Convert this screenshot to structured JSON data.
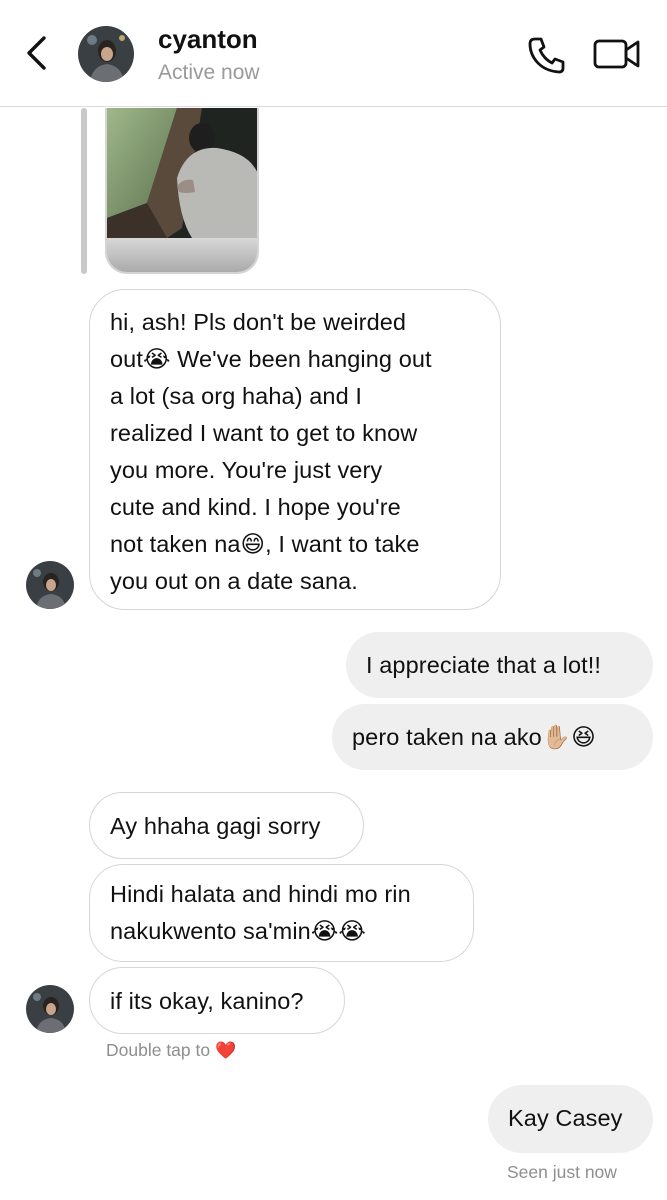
{
  "header": {
    "username": "cyanton",
    "status": "Active now"
  },
  "icons": {
    "back": "chevron-left-icon",
    "call": "phone-icon",
    "video": "video-camera-icon",
    "heart": "heart-icon"
  },
  "messages": [
    {
      "sender": "them",
      "lines": [
        "hi, ash! Pls don't be weirded",
        "out😭 We've been hanging out",
        "a lot (sa org haha) and I",
        "realized I want to get to know",
        "you more. You're just very",
        "cute and kind. I hope you're",
        "not taken na😄, I want to take",
        "you out on a date sana."
      ]
    },
    {
      "sender": "me",
      "text": "I appreciate that a lot!!"
    },
    {
      "sender": "me",
      "text": "pero taken na ako✋🏼😆"
    },
    {
      "sender": "them",
      "text": "Ay hhaha gagi sorry"
    },
    {
      "sender": "them",
      "lines": [
        "Hindi halata and hindi mo rin",
        "nakukwento sa'min😭😭"
      ]
    },
    {
      "sender": "them",
      "text": "if its okay, kanino?"
    },
    {
      "sender": "me",
      "text": "Kay Casey"
    }
  ],
  "hints": {
    "double_tap": "Double tap to",
    "heart": "❤️",
    "seen": "Seen just now"
  },
  "colors": {
    "outgoing_bubble": "#efefef",
    "incoming_border": "#d6d6d6",
    "muted_text": "#8e8e8e"
  }
}
